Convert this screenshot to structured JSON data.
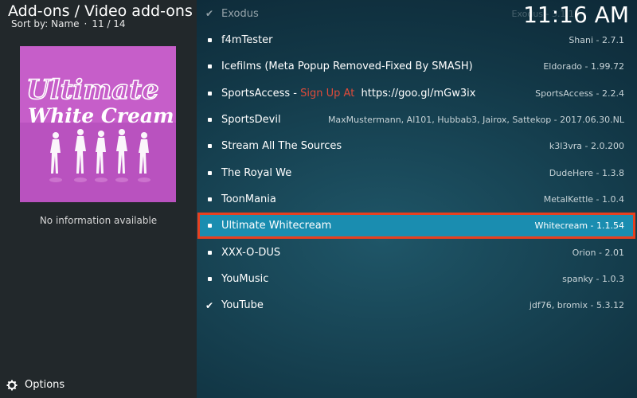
{
  "header": {
    "title": "Add-ons / Video add-ons",
    "sort_label": "Sort by: Name",
    "separator": "·",
    "position": "11 / 14"
  },
  "clock": "11:16 AM",
  "thumbnail": {
    "line1": "Ultimate",
    "line2": "White Cream",
    "icon": "silhouettes-image",
    "background": "#c65ec9"
  },
  "info_text": "No information available",
  "footer": {
    "options_label": "Options",
    "icon": "gear-icon"
  },
  "addons": [
    {
      "name": "Exodus",
      "meta": "Exodus - 3.1.13",
      "icon": "check-icon"
    },
    {
      "name": "f4mTester",
      "meta": "Shani - 2.7.1",
      "icon": "bullet-icon"
    },
    {
      "name": "Icefilms (Meta Popup Removed-Fixed By SMASH)",
      "meta": "Eldorado - 1.99.72",
      "icon": "bullet-icon"
    },
    {
      "name_prefix": "SportsAccess - ",
      "name_highlight": "Sign Up At",
      "name_suffix": "  https://goo.gl/mGw3ix",
      "meta": "SportsAccess - 2.2.4",
      "icon": "bullet-icon"
    },
    {
      "name": "SportsDevil",
      "meta": "MaxMustermann, Al101, Hubbab3, Jairox, Sattekop - 2017.06.30.NL",
      "icon": "bullet-icon"
    },
    {
      "name": "Stream All The Sources",
      "meta": "k3l3vra - 2.0.200",
      "icon": "bullet-icon"
    },
    {
      "name": "The Royal We",
      "meta": "DudeHere - 1.3.8",
      "icon": "bullet-icon"
    },
    {
      "name": "ToonMania",
      "meta": "MetalKettle - 1.0.4",
      "icon": "bullet-icon"
    },
    {
      "name": "Ultimate Whitecream",
      "meta": "Whitecream - 1.1.54",
      "icon": "bullet-icon",
      "selected": true
    },
    {
      "name": "XXX-O-DUS",
      "meta": "Orion - 2.01",
      "icon": "bullet-icon"
    },
    {
      "name": "YouMusic",
      "meta": "spanky - 1.0.3",
      "icon": "bullet-icon"
    },
    {
      "name": "YouTube",
      "meta": "jdf76, bromix - 5.3.12",
      "icon": "check-icon"
    }
  ],
  "colors": {
    "selection": "#1a8db0",
    "selection_outline": "#e8401f",
    "signup_text": "#e14b3a",
    "sidebar": "#22282b"
  }
}
